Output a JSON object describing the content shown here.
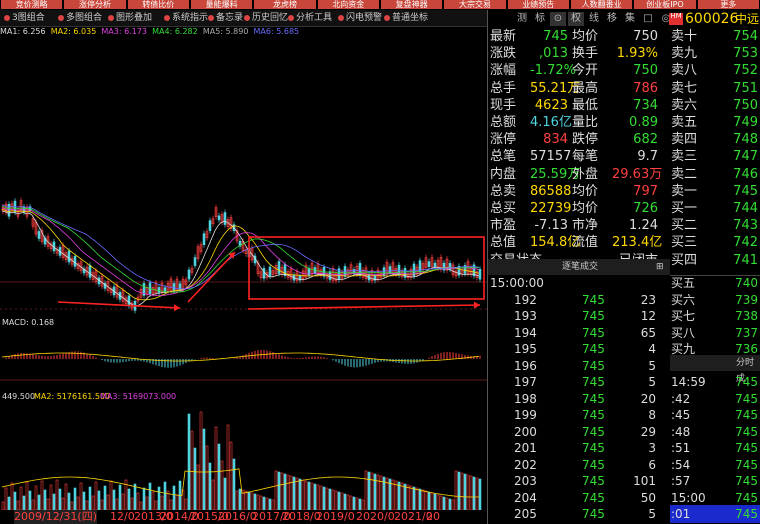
{
  "top_tabs": [
    "竞价测略",
    "涨停分析",
    "转债比价",
    "量能爆料",
    "龙虎榜",
    "北向资金",
    "复盘神器",
    "大宗交易",
    "业绩预告",
    "人数翻番业",
    "创业板IPO",
    "更多"
  ],
  "toolbar": {
    "combo1": "3图组合",
    "combo2": "多图组合",
    "items": [
      "图形叠加",
      "系统指示",
      "备忘录",
      "历史回忆",
      "分析工具",
      "闪电预警",
      "普通坐标"
    ]
  },
  "ma_line": {
    "ma1": "MA1: 6.256",
    "ma2": "MA2: 6.035",
    "ma3": "MA3: 6.173",
    "ma4": "MA4: 6.282",
    "ma5": "MA5: 5.890",
    "ma6": "MA6: 5.685"
  },
  "colors": {
    "up": "#ff4040",
    "down": "#4fd4e0",
    "flat": "#ffd800",
    "label": "#dddddd",
    "annot": "#ff2222"
  },
  "right_tabs": [
    "测",
    "标",
    "⊙",
    "权",
    "线",
    "移",
    "集",
    "□",
    "◎"
  ],
  "stock": {
    "code": "600026",
    "name": "中远",
    "tag": "HM"
  },
  "quote_rows": [
    {
      "l1": "最新",
      "v1": "745",
      "c1": "g",
      "l2": "均价",
      "v2": "750",
      "c2": "w",
      "l3": "卖十",
      "v3": "754",
      "c3": "g"
    },
    {
      "l1": "涨跌",
      "v1": ",013",
      "c1": "g",
      "l2": "换手",
      "v2": "1.93%",
      "c2": "y",
      "l3": "卖九",
      "v3": "753",
      "c3": "g"
    },
    {
      "l1": "涨幅",
      "v1": "-1.72%",
      "c1": "g",
      "l2": "今开",
      "v2": "750",
      "c2": "g",
      "l3": "卖八",
      "v3": "752",
      "c3": "g"
    },
    {
      "l1": "总手",
      "v1": "55.21万",
      "c1": "y",
      "l2": "最高",
      "v2": "786",
      "c2": "r",
      "l3": "卖七",
      "v3": "751",
      "c3": "g"
    },
    {
      "l1": "现手",
      "v1": "4623",
      "c1": "y",
      "l2": "最低",
      "v2": "734",
      "c2": "g",
      "l3": "卖六",
      "v3": "750",
      "c3": "g"
    },
    {
      "l1": "总额",
      "v1": "4.16亿",
      "c1": "c",
      "l2": "量比",
      "v2": "0.89",
      "c2": "g",
      "l3": "卖五",
      "v3": "749",
      "c3": "g"
    },
    {
      "l1": "涨停",
      "v1": "834",
      "c1": "r",
      "l2": "跌停",
      "v2": "682",
      "c2": "g",
      "l3": "卖四",
      "v3": "748",
      "c3": "g"
    },
    {
      "l1": "总笔",
      "v1": "57157",
      "c1": "w",
      "l2": "每笔",
      "v2": "9.7",
      "c2": "w",
      "l3": "卖三",
      "v3": "747",
      "c3": "g"
    },
    {
      "l1": "内盘",
      "v1": "25.59万",
      "c1": "g",
      "l2": "外盘",
      "v2": "29.63万",
      "c2": "r",
      "l3": "卖二",
      "v3": "746",
      "c3": "g"
    },
    {
      "l1": "总卖",
      "v1": "86588",
      "c1": "y",
      "l2": "均价",
      "v2": "797",
      "c2": "r",
      "l3": "卖一",
      "v3": "745",
      "c3": "g"
    },
    {
      "l1": "总买",
      "v1": "22739",
      "c1": "y",
      "l2": "均价",
      "v2": "726",
      "c2": "g",
      "l3": "买一",
      "v3": "744",
      "c3": "g"
    },
    {
      "l1": "市盈",
      "v1": "-7.13",
      "c1": "w",
      "l2": "市净",
      "v2": "1.24",
      "c2": "w",
      "l3": "买二",
      "v3": "743",
      "c3": "g"
    },
    {
      "l1": "总值",
      "v1": "154.8亿",
      "c1": "y",
      "l2": "流值",
      "v2": "213.4亿",
      "c2": "y",
      "l3": "买三",
      "v3": "742",
      "c3": "g"
    },
    {
      "l1": "交易状态",
      "v1": "",
      "c1": "w",
      "l2": "",
      "v2": "已闭市",
      "c2": "w",
      "l3": "买四",
      "v3": "741",
      "c3": "g"
    }
  ],
  "ticks_header": {
    "title": "逐笔成交",
    "btn": "⊞"
  },
  "ticks": [
    {
      "n": "",
      "p": "15:00:00",
      "v": "",
      "s": "买五",
      "sv": "740"
    },
    {
      "n": "192",
      "p": "745",
      "v": "23",
      "s": "买六",
      "sv": "739"
    },
    {
      "n": "193",
      "p": "745",
      "v": "12",
      "s": "买七",
      "sv": "738"
    },
    {
      "n": "194",
      "p": "745",
      "v": "65",
      "s": "买八",
      "sv": "737"
    },
    {
      "n": "195",
      "p": "745",
      "v": "4",
      "s": "买九",
      "sv": "736"
    },
    {
      "n": "196",
      "p": "745",
      "v": "5",
      "s": "",
      "sv": ""
    },
    {
      "n": "197",
      "p": "745",
      "v": "5",
      "s": "14:59",
      "sv": "745"
    },
    {
      "n": "198",
      "p": "745",
      "v": "20",
      "s": ":42",
      "sv": "745"
    },
    {
      "n": "199",
      "p": "745",
      "v": "8",
      "s": ":45",
      "sv": "745"
    },
    {
      "n": "200",
      "p": "745",
      "v": "29",
      "s": ":48",
      "sv": "745"
    },
    {
      "n": "201",
      "p": "745",
      "v": "3",
      "s": ":51",
      "sv": "745"
    },
    {
      "n": "202",
      "p": "745",
      "v": "6",
      "s": ":54",
      "sv": "745"
    },
    {
      "n": "203",
      "p": "745",
      "v": "101",
      "s": ":57",
      "sv": "745"
    },
    {
      "n": "204",
      "p": "745",
      "v": "50",
      "s": "15:00",
      "sv": "745"
    },
    {
      "n": "205",
      "p": "745",
      "v": "5",
      "s": ":01",
      "sv": "745"
    }
  ],
  "fenshi_label": "分时成",
  "sub_labels": {
    "macd": "MACD: 0.168",
    "vol_ma1": "449.500",
    "vol_ma2": "MA2: 5176161.500",
    "vol_ma3": "MA3: 5169073.000"
  },
  "axis_labels": {
    "date": "2009/12/31(四)",
    "years": [
      "12/0",
      "2013/0",
      "2014/0",
      "2015/0",
      "2016/0",
      "2017/0",
      "2018/0",
      "2019/0",
      "2020/0",
      "2021/0",
      "20"
    ]
  }
}
